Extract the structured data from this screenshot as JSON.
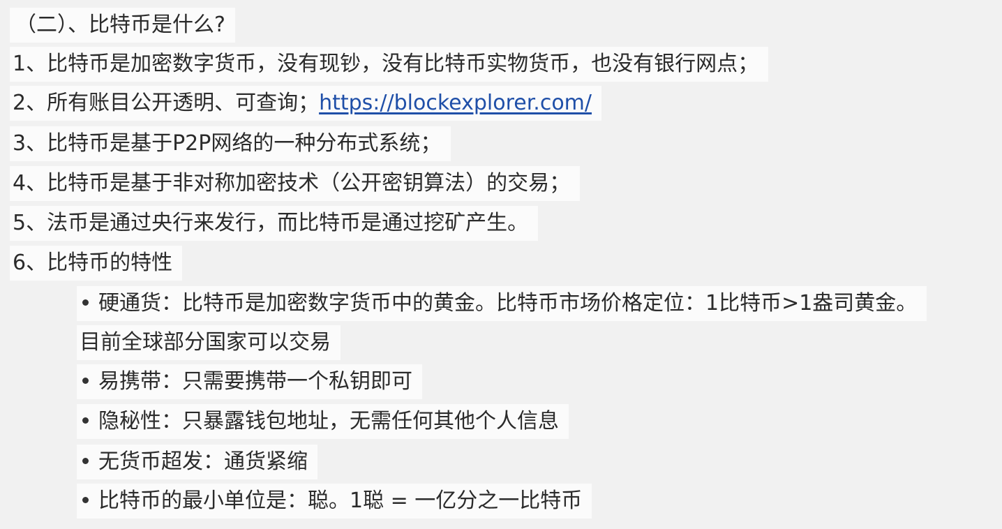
{
  "section_title": "（二）、比特币是什么?",
  "items": [
    {
      "text": "1、比特币是加密数字货币，没有现钞，没有比特币实物货币，也没有银行网点；"
    },
    {
      "text": "2、所有账目公开透明、可查询；",
      "link": "https://blockexplorer.com/"
    },
    {
      "text": "3、比特币是基于P2P网络的一种分布式系统；"
    },
    {
      "text": "4、比特币是基于非对称加密技术（公开密钥算法）的交易；"
    },
    {
      "text": "5、法币是通过央行来发行，而比特币是通过挖矿产生。"
    },
    {
      "text": "6、比特币的特性"
    }
  ],
  "features": [
    {
      "text": "硬通货：比特币是加密数字货币中的黄金。比特币市场价格定位：1比特币>1盎司黄金。",
      "continuation": "目前全球部分国家可以交易"
    },
    {
      "text": "易携带：只需要携带一个私钥即可"
    },
    {
      "text": "隐秘性：只暴露钱包地址，无需任何其他个人信息"
    },
    {
      "text": "无货币超发：通货紧缩"
    },
    {
      "text": "比特币的最小单位是：聪。1聪 = 一亿分之一比特币"
    }
  ]
}
